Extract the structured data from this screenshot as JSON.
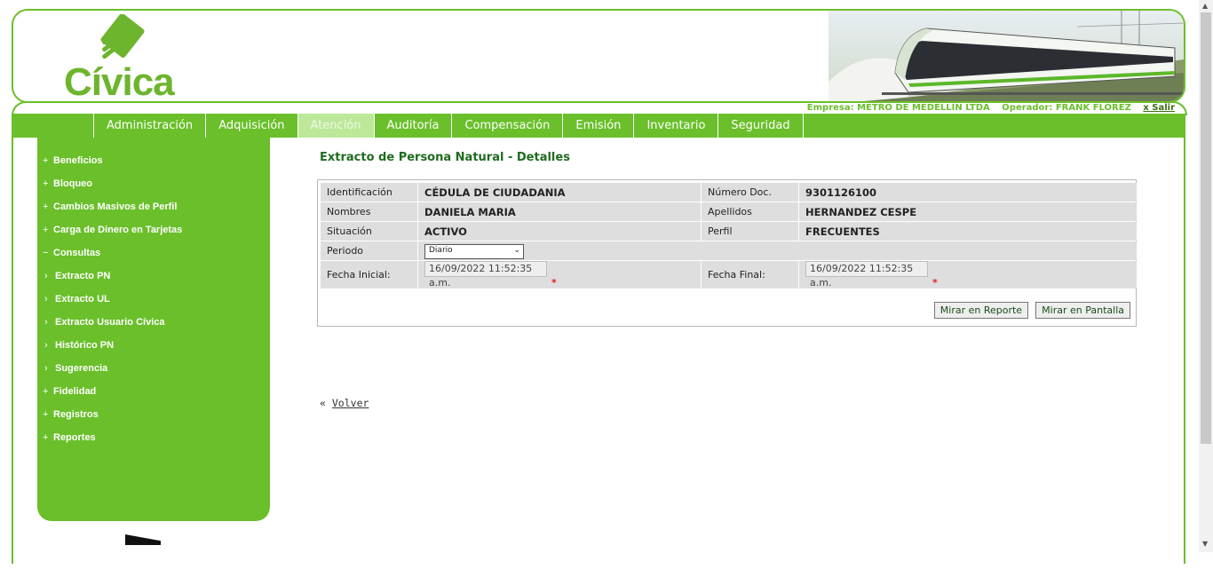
{
  "brand": {
    "name": "Cívica"
  },
  "topinfo": {
    "empresa": "Empresa: METRO DE MEDELLÍN LTDA",
    "operador": "Operador: FRANK FLOREZ",
    "salir": "x Salir"
  },
  "nav": {
    "items": [
      {
        "label": "Administración"
      },
      {
        "label": "Adquisición"
      },
      {
        "label": "Atención"
      },
      {
        "label": "Auditoría"
      },
      {
        "label": "Compensación"
      },
      {
        "label": "Emisión"
      },
      {
        "label": "Inventario"
      },
      {
        "label": "Seguridad"
      }
    ],
    "active": "Atención"
  },
  "sidebar": {
    "items": [
      {
        "marker": "+",
        "label": "Beneficios"
      },
      {
        "marker": "+",
        "label": "Bloqueo"
      },
      {
        "marker": "+",
        "label": "Cambios Masivos de Perfil"
      },
      {
        "marker": "+",
        "label": "Carga de Dinero en Tarjetas"
      },
      {
        "marker": "−",
        "label": "Consultas"
      },
      {
        "marker": "›",
        "label": "Extracto PN"
      },
      {
        "marker": "›",
        "label": "Extracto UL"
      },
      {
        "marker": "›",
        "label": "Extracto Usuario Cívica"
      },
      {
        "marker": "›",
        "label": "Histórico PN"
      },
      {
        "marker": "›",
        "label": "Sugerencia"
      },
      {
        "marker": "+",
        "label": "Fidelidad"
      },
      {
        "marker": "+",
        "label": "Registros"
      },
      {
        "marker": "+",
        "label": "Reportes"
      }
    ]
  },
  "page": {
    "title": "Extracto de Persona Natural - Detalles"
  },
  "details": {
    "identificacion_label": "Identificación",
    "identificacion_value": "CÉDULA DE CIUDADANIA",
    "numero_doc_label": "Número Doc.",
    "numero_doc_value": "9301126100",
    "nombres_label": "Nombres",
    "nombres_value": "DANIELA MARIA",
    "apellidos_label": "Apellidos",
    "apellidos_value": "HERNANDEZ CESPE",
    "situacion_label": "Situación",
    "situacion_value": "ACTIVO",
    "perfil_label": "Perfil",
    "perfil_value": "FRECUENTES",
    "periodo_label": "Periodo",
    "periodo_value": "Diario",
    "fecha_inicial_label": "Fecha Inicial:",
    "fecha_inicial_value": "16/09/2022 11:52:35 a.m.",
    "fecha_final_label": "Fecha Final:",
    "fecha_final_value": "16/09/2022 11:52:35 a.m.",
    "required_mark": "*"
  },
  "actions": {
    "mirar_reporte": "Mirar en Reporte",
    "mirar_pantalla": "Mirar en Pantalla"
  },
  "volver": {
    "prefix": "«",
    "label": "Volver"
  },
  "colors": {
    "brand_green": "#6abf2a",
    "active_tab": "#bde89a",
    "title_green": "#1f6b1f",
    "required": "#e02020"
  }
}
